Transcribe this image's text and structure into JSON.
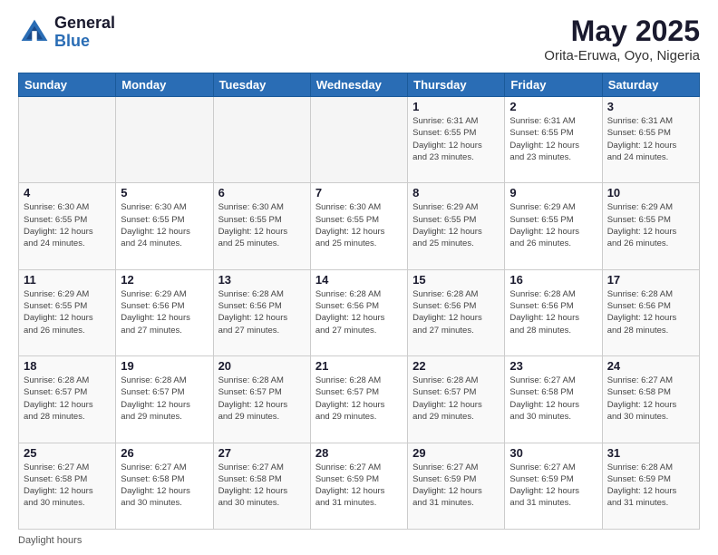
{
  "header": {
    "logo_general": "General",
    "logo_blue": "Blue",
    "title": "May 2025",
    "subtitle": "Orita-Eruwa, Oyo, Nigeria"
  },
  "days_of_week": [
    "Sunday",
    "Monday",
    "Tuesday",
    "Wednesday",
    "Thursday",
    "Friday",
    "Saturday"
  ],
  "footer": {
    "note": "Daylight hours"
  },
  "weeks": [
    [
      {
        "day": "",
        "info": ""
      },
      {
        "day": "",
        "info": ""
      },
      {
        "day": "",
        "info": ""
      },
      {
        "day": "",
        "info": ""
      },
      {
        "day": "1",
        "info": "Sunrise: 6:31 AM\nSunset: 6:55 PM\nDaylight: 12 hours\nand 23 minutes."
      },
      {
        "day": "2",
        "info": "Sunrise: 6:31 AM\nSunset: 6:55 PM\nDaylight: 12 hours\nand 23 minutes."
      },
      {
        "day": "3",
        "info": "Sunrise: 6:31 AM\nSunset: 6:55 PM\nDaylight: 12 hours\nand 24 minutes."
      }
    ],
    [
      {
        "day": "4",
        "info": "Sunrise: 6:30 AM\nSunset: 6:55 PM\nDaylight: 12 hours\nand 24 minutes."
      },
      {
        "day": "5",
        "info": "Sunrise: 6:30 AM\nSunset: 6:55 PM\nDaylight: 12 hours\nand 24 minutes."
      },
      {
        "day": "6",
        "info": "Sunrise: 6:30 AM\nSunset: 6:55 PM\nDaylight: 12 hours\nand 25 minutes."
      },
      {
        "day": "7",
        "info": "Sunrise: 6:30 AM\nSunset: 6:55 PM\nDaylight: 12 hours\nand 25 minutes."
      },
      {
        "day": "8",
        "info": "Sunrise: 6:29 AM\nSunset: 6:55 PM\nDaylight: 12 hours\nand 25 minutes."
      },
      {
        "day": "9",
        "info": "Sunrise: 6:29 AM\nSunset: 6:55 PM\nDaylight: 12 hours\nand 26 minutes."
      },
      {
        "day": "10",
        "info": "Sunrise: 6:29 AM\nSunset: 6:55 PM\nDaylight: 12 hours\nand 26 minutes."
      }
    ],
    [
      {
        "day": "11",
        "info": "Sunrise: 6:29 AM\nSunset: 6:55 PM\nDaylight: 12 hours\nand 26 minutes."
      },
      {
        "day": "12",
        "info": "Sunrise: 6:29 AM\nSunset: 6:56 PM\nDaylight: 12 hours\nand 27 minutes."
      },
      {
        "day": "13",
        "info": "Sunrise: 6:28 AM\nSunset: 6:56 PM\nDaylight: 12 hours\nand 27 minutes."
      },
      {
        "day": "14",
        "info": "Sunrise: 6:28 AM\nSunset: 6:56 PM\nDaylight: 12 hours\nand 27 minutes."
      },
      {
        "day": "15",
        "info": "Sunrise: 6:28 AM\nSunset: 6:56 PM\nDaylight: 12 hours\nand 27 minutes."
      },
      {
        "day": "16",
        "info": "Sunrise: 6:28 AM\nSunset: 6:56 PM\nDaylight: 12 hours\nand 28 minutes."
      },
      {
        "day": "17",
        "info": "Sunrise: 6:28 AM\nSunset: 6:56 PM\nDaylight: 12 hours\nand 28 minutes."
      }
    ],
    [
      {
        "day": "18",
        "info": "Sunrise: 6:28 AM\nSunset: 6:57 PM\nDaylight: 12 hours\nand 28 minutes."
      },
      {
        "day": "19",
        "info": "Sunrise: 6:28 AM\nSunset: 6:57 PM\nDaylight: 12 hours\nand 29 minutes."
      },
      {
        "day": "20",
        "info": "Sunrise: 6:28 AM\nSunset: 6:57 PM\nDaylight: 12 hours\nand 29 minutes."
      },
      {
        "day": "21",
        "info": "Sunrise: 6:28 AM\nSunset: 6:57 PM\nDaylight: 12 hours\nand 29 minutes."
      },
      {
        "day": "22",
        "info": "Sunrise: 6:28 AM\nSunset: 6:57 PM\nDaylight: 12 hours\nand 29 minutes."
      },
      {
        "day": "23",
        "info": "Sunrise: 6:27 AM\nSunset: 6:58 PM\nDaylight: 12 hours\nand 30 minutes."
      },
      {
        "day": "24",
        "info": "Sunrise: 6:27 AM\nSunset: 6:58 PM\nDaylight: 12 hours\nand 30 minutes."
      }
    ],
    [
      {
        "day": "25",
        "info": "Sunrise: 6:27 AM\nSunset: 6:58 PM\nDaylight: 12 hours\nand 30 minutes."
      },
      {
        "day": "26",
        "info": "Sunrise: 6:27 AM\nSunset: 6:58 PM\nDaylight: 12 hours\nand 30 minutes."
      },
      {
        "day": "27",
        "info": "Sunrise: 6:27 AM\nSunset: 6:58 PM\nDaylight: 12 hours\nand 30 minutes."
      },
      {
        "day": "28",
        "info": "Sunrise: 6:27 AM\nSunset: 6:59 PM\nDaylight: 12 hours\nand 31 minutes."
      },
      {
        "day": "29",
        "info": "Sunrise: 6:27 AM\nSunset: 6:59 PM\nDaylight: 12 hours\nand 31 minutes."
      },
      {
        "day": "30",
        "info": "Sunrise: 6:27 AM\nSunset: 6:59 PM\nDaylight: 12 hours\nand 31 minutes."
      },
      {
        "day": "31",
        "info": "Sunrise: 6:28 AM\nSunset: 6:59 PM\nDaylight: 12 hours\nand 31 minutes."
      }
    ]
  ]
}
